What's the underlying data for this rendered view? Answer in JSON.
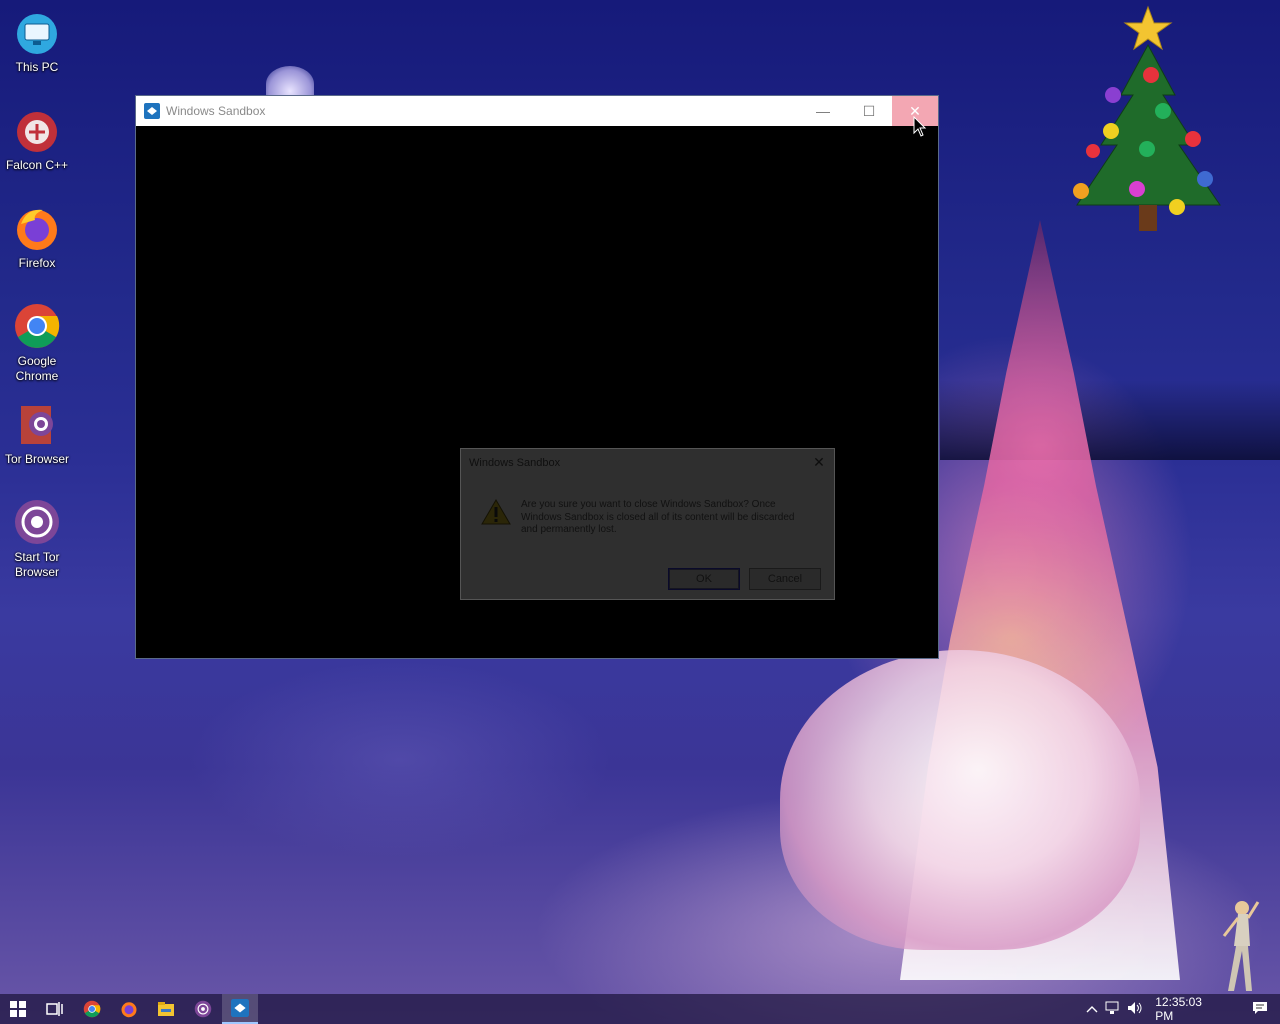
{
  "desktop": {
    "icons": [
      {
        "label": "This PC",
        "icon": "this-pc-icon"
      },
      {
        "label": "Falcon C++",
        "icon": "falcon-cpp-icon"
      },
      {
        "label": "Firefox",
        "icon": "firefox-icon"
      },
      {
        "label": "Google Chrome",
        "icon": "chrome-icon"
      },
      {
        "label": "Tor Browser",
        "icon": "tor-browser-icon"
      },
      {
        "label": "Start Tor Browser",
        "icon": "start-tor-browser-icon"
      }
    ]
  },
  "window": {
    "title": "Windows Sandbox",
    "minimize_glyph": "—",
    "maximize_glyph": "☐",
    "close_glyph": "✕",
    "close_hover_color": "#f3a7b3"
  },
  "dialog": {
    "title": "Windows Sandbox",
    "close_glyph": "✕",
    "message": "Are you sure you want to close Windows Sandbox? Once Windows Sandbox is closed all of its content will be discarded and permanently lost.",
    "ok_label": "OK",
    "cancel_label": "Cancel",
    "icon": "warning-icon"
  },
  "taskbar": {
    "items": [
      "start-icon",
      "task-view-icon",
      "chrome-icon",
      "firefox-icon",
      "file-explorer-icon",
      "tor-browser-icon",
      "windows-sandbox-icon"
    ],
    "active_item": "windows-sandbox-icon",
    "clock": "12:35:03 PM"
  }
}
